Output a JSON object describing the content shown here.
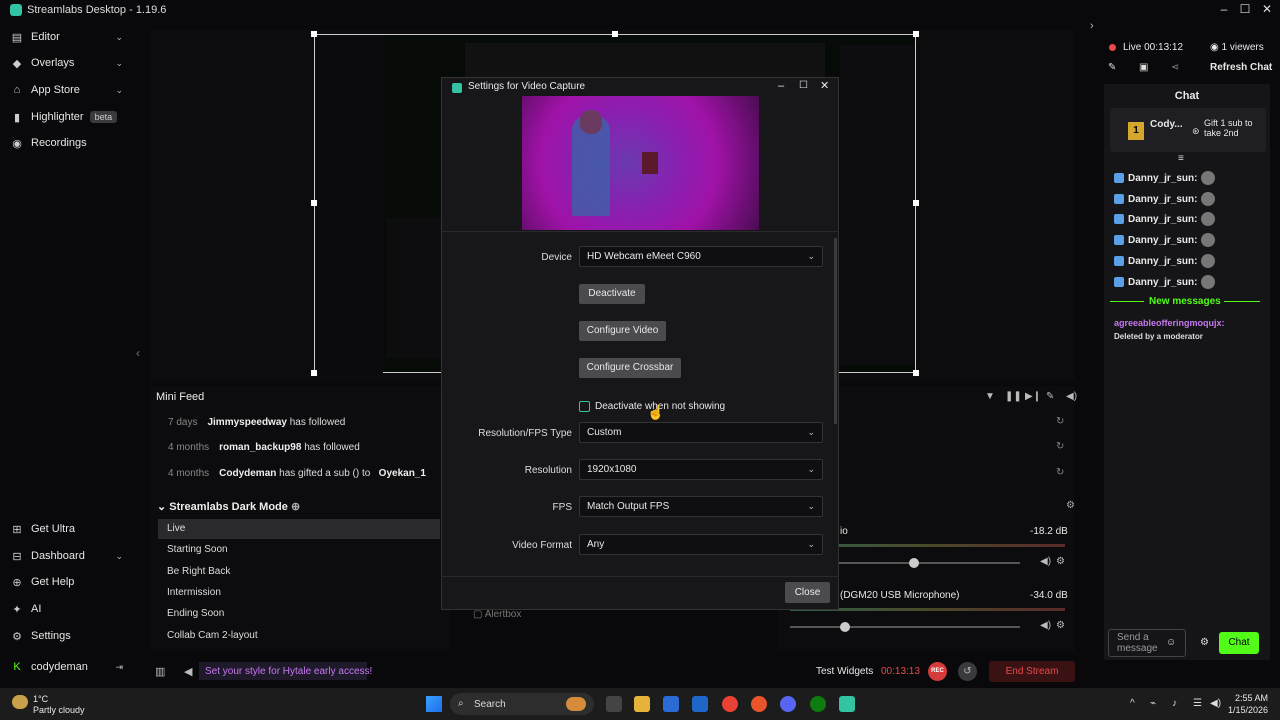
{
  "app": {
    "title": "Streamlabs Desktop - 1.19.6"
  },
  "sidebar": {
    "top_items": [
      {
        "label": "Editor"
      },
      {
        "label": "Overlays"
      },
      {
        "label": "App Store"
      },
      {
        "label": "Highlighter",
        "badge": "beta"
      },
      {
        "label": "Recordings"
      }
    ],
    "bottom_items": [
      {
        "label": "Get Ultra"
      },
      {
        "label": "Dashboard"
      },
      {
        "label": "Get Help"
      },
      {
        "label": "AI"
      },
      {
        "label": "Settings"
      }
    ],
    "user": "codydeman"
  },
  "mini_feed": {
    "title": "Mini Feed",
    "items": [
      {
        "time": "7 days",
        "user": "Jimmyspeedway",
        "text": "has followed",
        "extra": ""
      },
      {
        "time": "4 months",
        "user": "roman_backup98",
        "text": "has followed",
        "extra": ""
      },
      {
        "time": "4 months",
        "user": "Codydeman",
        "text": "has gifted a sub () to",
        "extra": "Oyekan_1"
      }
    ]
  },
  "scenes": {
    "collection": "Streamlabs Dark Mode",
    "items": [
      "Live",
      "Starting Soon",
      "Be Right Back",
      "Intermission",
      "Ending Soon",
      "Collab Cam 2-layout"
    ],
    "selected": "Live"
  },
  "sources": {
    "visible_item": "Alertbox"
  },
  "mixer": {
    "items": [
      {
        "label": "io",
        "db": "-18.2 dB",
        "level": 0.54
      },
      {
        "label": "(DGM20 USB Microphone)",
        "db": "-34.0 dB",
        "level": 0.24
      }
    ]
  },
  "dialog": {
    "title": "Settings for Video Capture",
    "device_label": "Device",
    "device_value": "HD Webcam eMeet C960",
    "deactivate": "Deactivate",
    "configure_video": "Configure Video",
    "configure_crossbar": "Configure Crossbar",
    "deactivate_checkbox": "Deactivate when not showing",
    "res_type_label": "Resolution/FPS Type",
    "res_type_value": "Custom",
    "resolution_label": "Resolution",
    "resolution_value": "1920x1080",
    "fps_label": "FPS",
    "fps_value": "Match Output FPS",
    "video_format_label": "Video Format",
    "video_format_value": "Any",
    "close": "Close"
  },
  "live": {
    "status": "Live 00:13:12",
    "viewers": "1 viewers",
    "refresh_chat": "Refresh Chat"
  },
  "chat": {
    "title": "Chat",
    "pinned_user": "Cody...",
    "pinned_count": "1",
    "gift_text": "Gift 1 sub to take 2nd",
    "messages": [
      "Danny_jr_sun:",
      "Danny_jr_sun:",
      "Danny_jr_sun:",
      "Danny_jr_sun:",
      "Danny_jr_sun:",
      "Danny_jr_sun:"
    ],
    "new_messages": "New messages",
    "last_user": "agreeableofferingmoqujx:",
    "last_text": "Deleted by a moderator",
    "placeholder": "Send a message",
    "send": "Chat"
  },
  "bottom_bar": {
    "promo": "Set your style for Hytale early access!",
    "test_widgets": "Test Widgets",
    "timer": "00:13:13",
    "rec": "REC",
    "end_stream": "End Stream"
  },
  "taskbar": {
    "temp": "1°C",
    "weather": "Partly cloudy",
    "search": "Search",
    "time": "2:55 AM",
    "date": "1/15/2026"
  },
  "colors": {
    "accent": "#31c3a2",
    "live_red": "#e84a4a",
    "chat_green": "#53fc18"
  }
}
